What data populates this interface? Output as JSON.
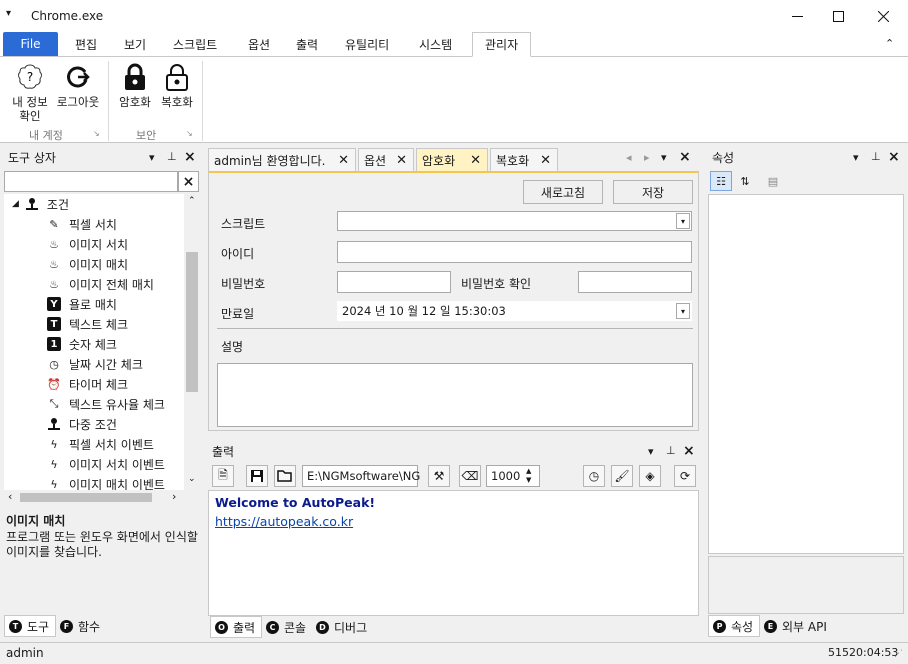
{
  "window": {
    "title": "Chrome.exe",
    "system_menu": "▾"
  },
  "menu": {
    "file": "File",
    "tabs": [
      "편집",
      "보기",
      "스크립트",
      "옵션",
      "출력",
      "유틸리티",
      "시스템",
      "관리자"
    ],
    "active": "관리자",
    "collapse_icon": "⌃"
  },
  "ribbon": {
    "account": {
      "my_info_line1": "내 정보",
      "my_info_line2": "확인",
      "logout": "로그아웃",
      "group": "내 계정"
    },
    "security": {
      "encrypt": "암호화",
      "decrypt": "복호화",
      "group": "보안"
    }
  },
  "toolbox": {
    "title": "도구 상자",
    "root": "조건",
    "items": [
      "픽셀 서치",
      "이미지 서치",
      "이미지 매치",
      "이미지 전체 매치",
      "욜로 매치",
      "텍스트 체크",
      "숫자 체크",
      "날짜 시간 체크",
      "타이머 체크",
      "텍스트 유사율 체크",
      "다중 조건",
      "픽셀 서치 이벤트",
      "이미지 서치 이벤트",
      "이미지 매치 이벤트"
    ],
    "desc_title": "이미지 매치",
    "desc_text": "프로그램 또는 윈도우 화면에서 인식할 이미지를 찾습니다.",
    "tabs": [
      {
        "badge": "T",
        "label": "도구"
      },
      {
        "badge": "F",
        "label": "함수"
      }
    ]
  },
  "documents": {
    "tabs": [
      "admin님 환영합니다.",
      "옵션",
      "암호화",
      "복호화"
    ],
    "active": "암호화"
  },
  "form": {
    "refresh": "새로고침",
    "save": "저장",
    "script_label": "스크립트",
    "script_value": "",
    "id_label": "아이디",
    "id_value": "",
    "pw_label": "비밀번호",
    "pw_value": "",
    "pw_confirm_label": "비밀번호 확인",
    "pw_confirm_value": "",
    "expiry_label": "만료일",
    "expiry_value": "2024 년 10 월 12 일 15:30:03",
    "desc_label": "설명",
    "desc_value": ""
  },
  "output": {
    "title": "출력",
    "path": "E:\\NGMsoftware\\NG",
    "count": "1000",
    "lines": [
      "Welcome to AutoPeak!",
      "https://autopeak.co.kr"
    ],
    "tabs": [
      {
        "badge": "O",
        "label": "출력"
      },
      {
        "badge": "C",
        "label": "콘솔"
      },
      {
        "badge": "D",
        "label": "디버그"
      }
    ]
  },
  "properties": {
    "title": "속성",
    "tabs": [
      {
        "badge": "P",
        "label": "속성"
      },
      {
        "badge": "E",
        "label": "외부 API"
      }
    ]
  },
  "status": {
    "user": "admin",
    "clock": "51520:04:53"
  }
}
